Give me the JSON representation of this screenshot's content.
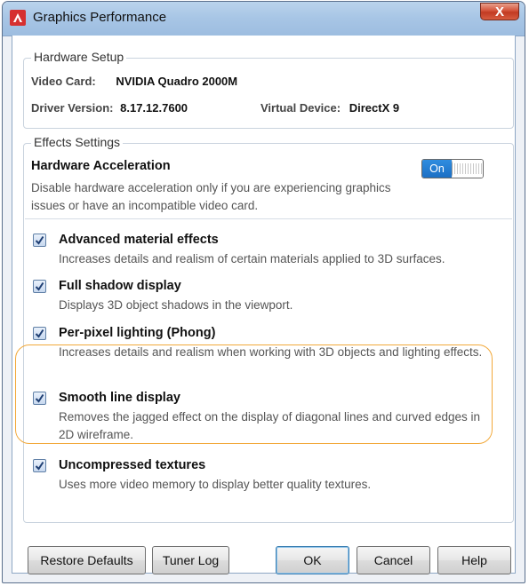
{
  "window": {
    "title": "Graphics Performance",
    "close_label": "X"
  },
  "hardware_setup": {
    "legend": "Hardware Setup",
    "video_card_label": "Video Card:",
    "video_card_value": "NVIDIA Quadro 2000M",
    "driver_version_label": "Driver Version:",
    "driver_version_value": "8.17.12.7600",
    "virtual_device_label": "Virtual Device:",
    "virtual_device_value": "DirectX 9"
  },
  "effects_settings": {
    "legend": "Effects Settings",
    "hardware_acceleration": {
      "title": "Hardware Acceleration",
      "description": "Disable hardware acceleration only if you are experiencing graphics issues or have an incompatible video card.",
      "toggle_label": "On",
      "toggle_state": "on"
    },
    "options": [
      {
        "title": "Advanced material effects",
        "description": "Increases details and realism of certain materials applied to 3D surfaces.",
        "checked": true
      },
      {
        "title": "Full shadow display",
        "description": "Displays 3D object shadows in the viewport.",
        "checked": true
      },
      {
        "title": "Per-pixel lighting (Phong)",
        "description": "Increases details and realism when working with 3D objects and lighting effects.",
        "checked": true
      },
      {
        "title": "Smooth line display",
        "description": "Removes the jagged effect on the display of diagonal lines and curved edges in 2D wireframe.",
        "checked": true,
        "highlighted": true
      },
      {
        "title": "Uncompressed textures",
        "description": "Uses more video memory to display better quality textures.",
        "checked": true
      }
    ]
  },
  "buttons": {
    "restore_defaults": "Restore Defaults",
    "tuner_log": "Tuner Log",
    "ok": "OK",
    "cancel": "Cancel",
    "help": "Help"
  },
  "colors": {
    "highlight": "#f2a93b",
    "toggle_on": "#1c6fc4",
    "app_icon": "#d63030"
  }
}
